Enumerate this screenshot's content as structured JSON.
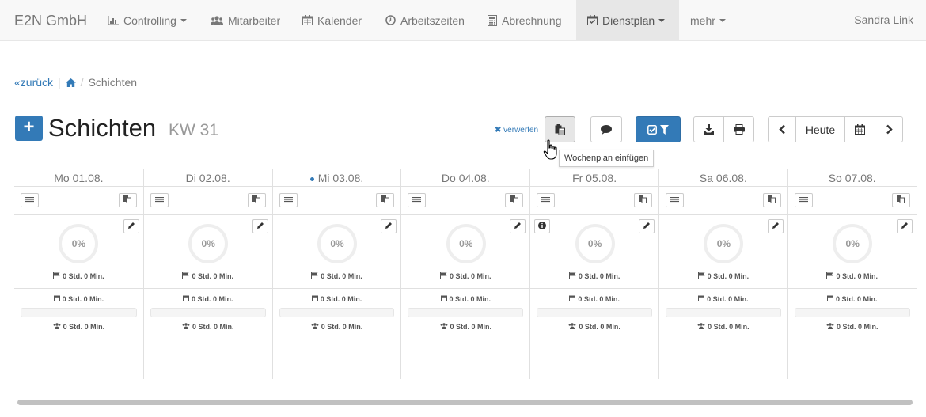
{
  "navbar": {
    "brand": "E2N GmbH",
    "items": [
      {
        "label": "Controlling",
        "icon": "bar-chart-icon",
        "dropdown": true
      },
      {
        "label": "Mitarbeiter",
        "icon": "users-icon"
      },
      {
        "label": "Kalender",
        "icon": "calendar-icon"
      },
      {
        "label": "Arbeitszeiten",
        "icon": "clock-icon"
      },
      {
        "label": "Abrechnung",
        "icon": "calculator-icon"
      },
      {
        "label": "Dienstplan",
        "icon": "calendar-check-icon",
        "dropdown": true,
        "active": true
      },
      {
        "label": "mehr",
        "dropdown": true
      }
    ],
    "user": "Sandra Link"
  },
  "breadcrumb": {
    "back": "zurück",
    "current": "Schichten"
  },
  "header": {
    "title": "Schichten",
    "week": "KW 31",
    "discard": "verwerfen"
  },
  "toolbar": {
    "today": "Heute",
    "tooltip": "Wochenplan einfügen"
  },
  "colors": {
    "accent": "#337ab7",
    "nav_bg": "#f8f8f8"
  },
  "days": [
    {
      "label": "Mo 01.08.",
      "percent": "0%",
      "planned": "0 Std. 0 Min.",
      "calendar": "0 Std. 0 Min.",
      "staff": "0 Std. 0 Min.",
      "info": false,
      "today": false
    },
    {
      "label": "Di 02.08.",
      "percent": "0%",
      "planned": "0 Std. 0 Min.",
      "calendar": "0 Std. 0 Min.",
      "staff": "0 Std. 0 Min.",
      "info": false,
      "today": false
    },
    {
      "label": "Mi 03.08.",
      "percent": "0%",
      "planned": "0 Std. 0 Min.",
      "calendar": "0 Std. 0 Min.",
      "staff": "0 Std. 0 Min.",
      "info": false,
      "today": true
    },
    {
      "label": "Do 04.08.",
      "percent": "0%",
      "planned": "0 Std. 0 Min.",
      "calendar": "0 Std. 0 Min.",
      "staff": "0 Std. 0 Min.",
      "info": false,
      "today": false
    },
    {
      "label": "Fr 05.08.",
      "percent": "0%",
      "planned": "0 Std. 0 Min.",
      "calendar": "0 Std. 0 Min.",
      "staff": "0 Std. 0 Min.",
      "info": true,
      "today": false
    },
    {
      "label": "Sa 06.08.",
      "percent": "0%",
      "planned": "0 Std. 0 Min.",
      "calendar": "0 Std. 0 Min.",
      "staff": "0 Std. 0 Min.",
      "info": false,
      "today": false
    },
    {
      "label": "So 07.08.",
      "percent": "0%",
      "planned": "0 Std. 0 Min.",
      "calendar": "0 Std. 0 Min.",
      "staff": "0 Std. 0 Min.",
      "info": false,
      "today": false
    }
  ]
}
